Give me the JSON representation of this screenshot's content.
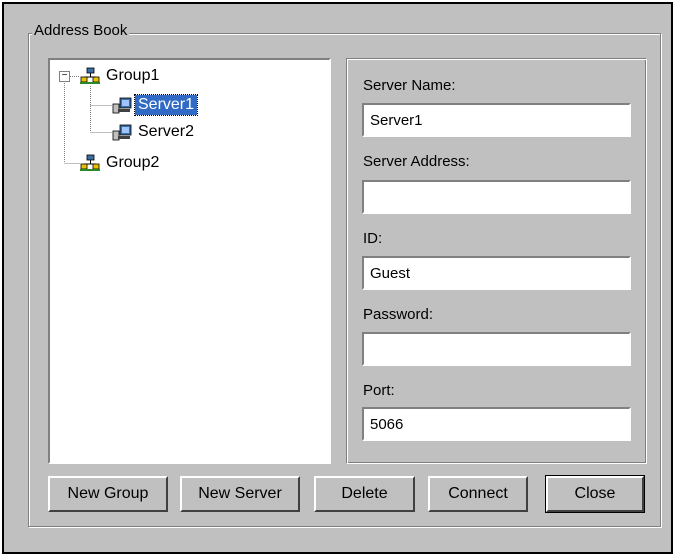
{
  "window": {
    "group_title": "Address Book"
  },
  "tree": {
    "groups": [
      {
        "label": "Group1",
        "expanded": true,
        "servers": [
          {
            "label": "Server1",
            "selected": true
          },
          {
            "label": "Server2",
            "selected": false
          }
        ]
      },
      {
        "label": "Group2",
        "expanded": false,
        "servers": []
      }
    ],
    "selection_color": "#316ac5"
  },
  "form": {
    "server_name_label": "Server Name:",
    "server_name_value": "Server1",
    "server_address_label": "Server Address:",
    "server_address_value": "",
    "id_label": "ID:",
    "id_value": "Guest",
    "password_label": "Password:",
    "password_value": "",
    "port_label": "Port:",
    "port_value": "5066"
  },
  "buttons": {
    "new_group": "New Group",
    "new_server": "New Server",
    "delete": "Delete",
    "connect": "Connect",
    "close": "Close"
  }
}
